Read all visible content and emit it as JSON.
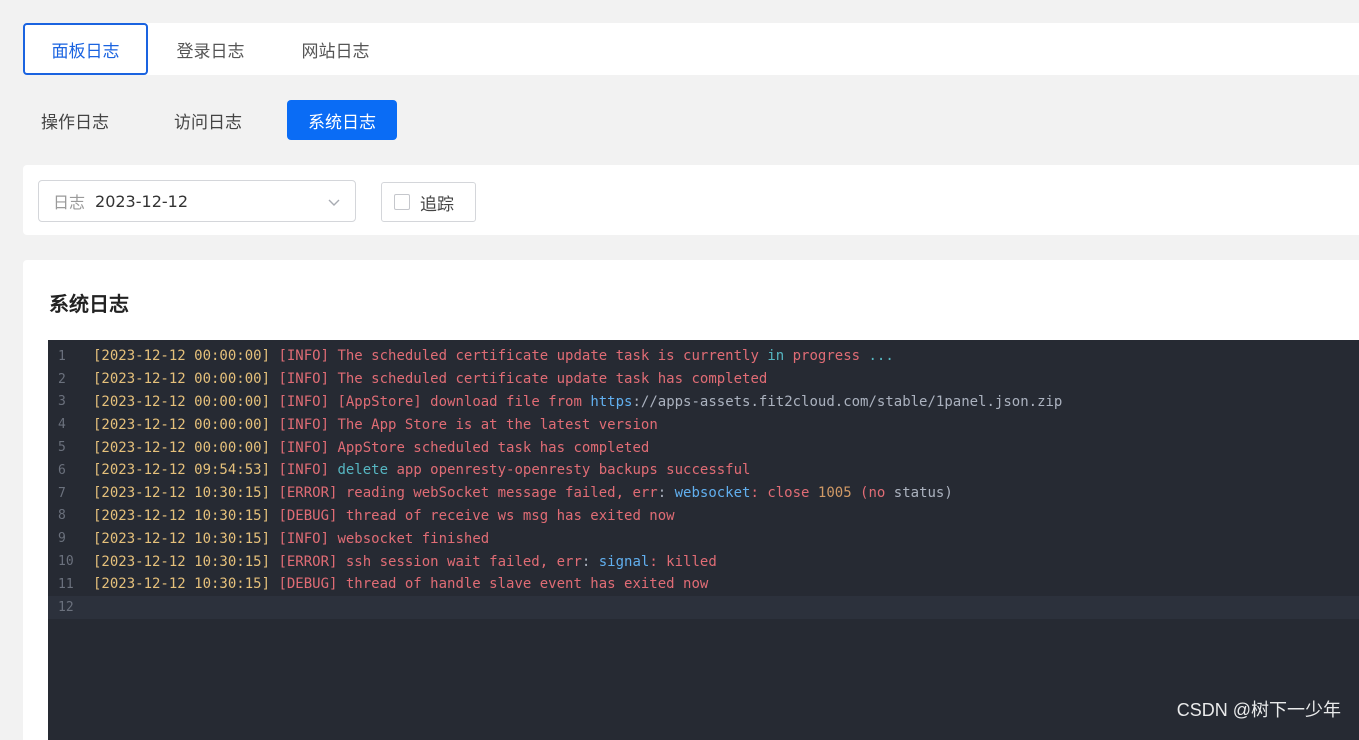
{
  "top_tabs": [
    {
      "label": "面板日志",
      "active": true
    },
    {
      "label": "登录日志",
      "active": false
    },
    {
      "label": "网站日志",
      "active": false
    }
  ],
  "sub_tabs": [
    {
      "label": "操作日志",
      "active": false
    },
    {
      "label": "访问日志",
      "active": false
    },
    {
      "label": "系统日志",
      "active": true
    }
  ],
  "filter": {
    "select_prefix": "日志",
    "select_value": "2023-12-12",
    "track_label": "追踪",
    "track_checked": false
  },
  "log_panel": {
    "title": "系统日志",
    "lines": [
      {
        "num": "1",
        "ts": "[2023-12-12 00:00:00]",
        "tag": "[INFO]",
        "parts": [
          {
            "t": "The scheduled certificate update task is currently ",
            "c": "msg"
          },
          {
            "t": "in",
            "c": "kw"
          },
          {
            "t": " progress ",
            "c": "msg"
          },
          {
            "t": "...",
            "c": "kw"
          }
        ]
      },
      {
        "num": "2",
        "ts": "[2023-12-12 00:00:00]",
        "tag": "[INFO]",
        "parts": [
          {
            "t": "The scheduled certificate update task has completed",
            "c": "msg"
          }
        ]
      },
      {
        "num": "3",
        "ts": "[2023-12-12 00:00:00]",
        "tag": "[INFO]",
        "parts": [
          {
            "t": "[AppStore] download file from ",
            "c": "msg"
          },
          {
            "t": "https",
            "c": "url"
          },
          {
            "t": "://apps-assets.fit2cloud.com/stable/1panel.json.zip",
            "c": "url-rest"
          }
        ]
      },
      {
        "num": "4",
        "ts": "[2023-12-12 00:00:00]",
        "tag": "[INFO]",
        "parts": [
          {
            "t": "The App Store is at the latest version",
            "c": "msg"
          }
        ]
      },
      {
        "num": "5",
        "ts": "[2023-12-12 00:00:00]",
        "tag": "[INFO]",
        "parts": [
          {
            "t": "AppStore scheduled task has completed",
            "c": "msg"
          }
        ]
      },
      {
        "num": "6",
        "ts": "[2023-12-12 09:54:53]",
        "tag": "[INFO]",
        "parts": [
          {
            "t": "delete",
            "c": "kw"
          },
          {
            "t": " app openresty-openresty backups successful",
            "c": "msg"
          }
        ]
      },
      {
        "num": "7",
        "ts": "[2023-12-12 10:30:15]",
        "tag": "[ERROR]",
        "parts": [
          {
            "t": "reading webSocket message failed, err",
            "c": "msg"
          },
          {
            "t": ": ",
            "c": "plain"
          },
          {
            "t": "websocket",
            "c": "url"
          },
          {
            "t": ": close ",
            "c": "msg"
          },
          {
            "t": "1005",
            "c": "num"
          },
          {
            "t": " (no ",
            "c": "msg"
          },
          {
            "t": "status)",
            "c": "plain"
          }
        ]
      },
      {
        "num": "8",
        "ts": "[2023-12-12 10:30:15]",
        "tag": "[DEBUG]",
        "parts": [
          {
            "t": "thread of receive ws msg has exited now",
            "c": "msg"
          }
        ]
      },
      {
        "num": "9",
        "ts": "[2023-12-12 10:30:15]",
        "tag": "[INFO]",
        "parts": [
          {
            "t": "websocket finished",
            "c": "msg"
          }
        ]
      },
      {
        "num": "10",
        "ts": "[2023-12-12 10:30:15]",
        "tag": "[ERROR]",
        "parts": [
          {
            "t": "ssh session wait failed, err",
            "c": "msg"
          },
          {
            "t": ": ",
            "c": "plain"
          },
          {
            "t": "signal",
            "c": "url"
          },
          {
            "t": ": killed",
            "c": "msg"
          }
        ]
      },
      {
        "num": "11",
        "ts": "[2023-12-12 10:30:15]",
        "tag": "[DEBUG]",
        "parts": [
          {
            "t": "thread of handle slave event has exited now",
            "c": "msg"
          }
        ]
      },
      {
        "num": "12",
        "ts": "",
        "tag": "",
        "parts": []
      }
    ]
  },
  "watermark": "CSDN @树下一少年",
  "colors": {
    "accent": "#0a6cf5",
    "active_tab_border": "#1a63e0",
    "editor_bg": "#262a33",
    "timestamp": "#e5c07b",
    "message": "#e06c75",
    "keyword": "#56b6c2",
    "link": "#61afef"
  }
}
